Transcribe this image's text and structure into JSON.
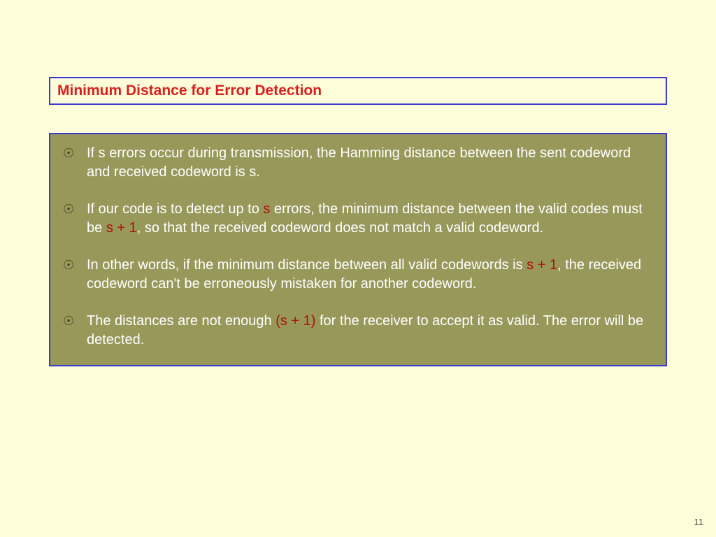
{
  "title": "Minimum Distance for Error Detection",
  "bullets": {
    "b1": {
      "text": "If s errors occur during transmission, the Hamming distance between the sent codeword and received codeword is s."
    },
    "b2": {
      "pre": "If our code is to detect up to ",
      "hl1": "s",
      "mid": " errors, the minimum distance between the valid codes must be ",
      "hl2": "s + 1",
      "post": ", so that the received codeword does not match a valid codeword."
    },
    "b3": {
      "pre": "In other words, if the minimum distance between all valid codewords is ",
      "hl1": "s + 1",
      "post": ", the received codeword can't be erroneously mistaken for another codeword."
    },
    "b4": {
      "pre": "The distances are not enough ",
      "hl1": "(s + 1)",
      "post": " for the receiver to accept it as valid. The error will be detected."
    }
  },
  "marker": "☉",
  "page": "11"
}
